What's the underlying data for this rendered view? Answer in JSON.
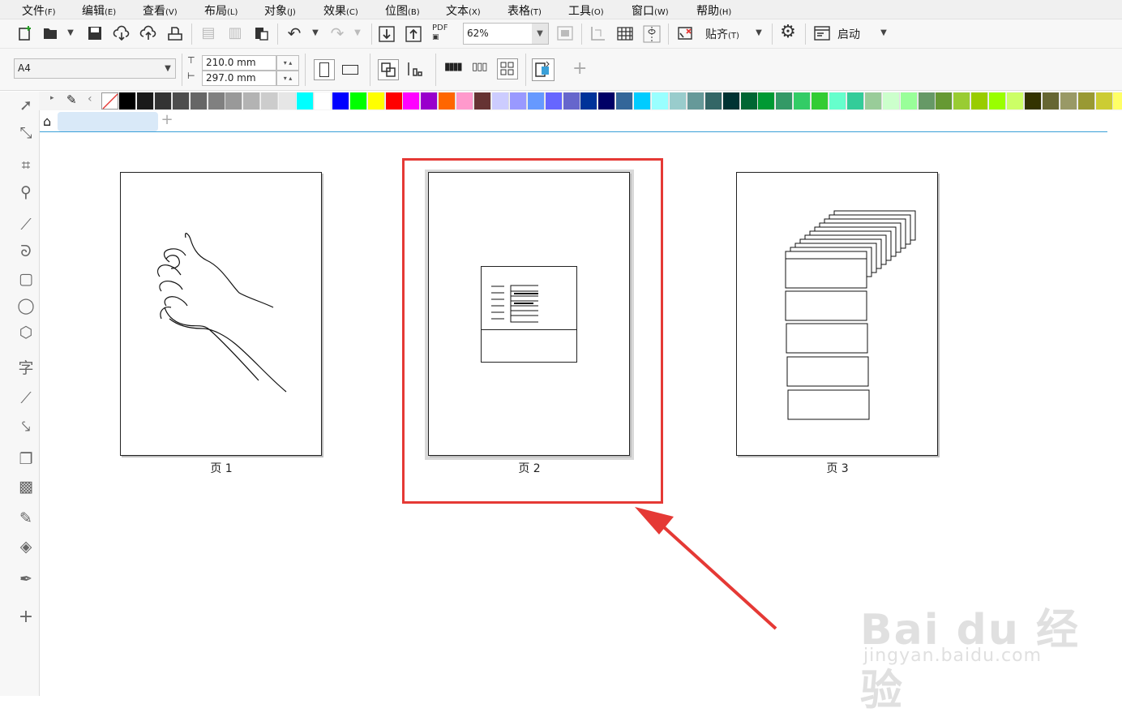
{
  "menubar": {
    "items": [
      {
        "label": "文件",
        "key": "(F)"
      },
      {
        "label": "编辑",
        "key": "(E)"
      },
      {
        "label": "查看",
        "key": "(V)"
      },
      {
        "label": "布局",
        "key": "(L)"
      },
      {
        "label": "对象",
        "key": "(J)"
      },
      {
        "label": "效果",
        "key": "(C)"
      },
      {
        "label": "位图",
        "key": "(B)"
      },
      {
        "label": "文本",
        "key": "(X)"
      },
      {
        "label": "表格",
        "key": "(T)"
      },
      {
        "label": "工具",
        "key": "(O)"
      },
      {
        "label": "窗口",
        "key": "(W)"
      },
      {
        "label": "帮助",
        "key": "(H)"
      }
    ]
  },
  "toolbar": {
    "zoom_value": "62%",
    "pdf_label": "PDF",
    "snap_label": "贴齐",
    "snap_key": "(T)",
    "launch_label": "启动"
  },
  "property_bar": {
    "paper_size": "A4",
    "width": "210.0 mm",
    "height": "297.0 mm"
  },
  "palette": {
    "colors": [
      "#000000",
      "#1a1a1a",
      "#333333",
      "#4d4d4d",
      "#666666",
      "#808080",
      "#999999",
      "#b3b3b3",
      "#cccccc",
      "#e6e6e6",
      "#00ffff",
      "#ffffff",
      "#0000ff",
      "#00ff00",
      "#ffff00",
      "#ff0000",
      "#ff00ff",
      "#9900cc",
      "#ff6600",
      "#ff99cc",
      "#663333",
      "#ccccff",
      "#9999ff",
      "#6699ff",
      "#6666ff",
      "#6666cc",
      "#003399",
      "#000066",
      "#336699",
      "#00ccff",
      "#99ffff",
      "#99cccc",
      "#669999",
      "#336666",
      "#003333",
      "#006633",
      "#009933",
      "#339966",
      "#33cc66",
      "#33cc33",
      "#66ffcc",
      "#33cc99",
      "#99cc99",
      "#ccffcc",
      "#99ff99",
      "#669966",
      "#669933",
      "#99cc33",
      "#99cc00",
      "#99ff00",
      "#ccff66",
      "#333300",
      "#666633",
      "#999966",
      "#999933",
      "#cccc33",
      "#ffff66",
      "#ffff99"
    ]
  },
  "pages": [
    {
      "label": "页 1"
    },
    {
      "label": "页 2"
    },
    {
      "label": "页 3"
    }
  ],
  "watermark": {
    "brand": "Bai du 经验",
    "url": "jingyan.baidu.com"
  },
  "colors": {
    "highlight": "#e53935",
    "accent": "#3aa0d8"
  }
}
